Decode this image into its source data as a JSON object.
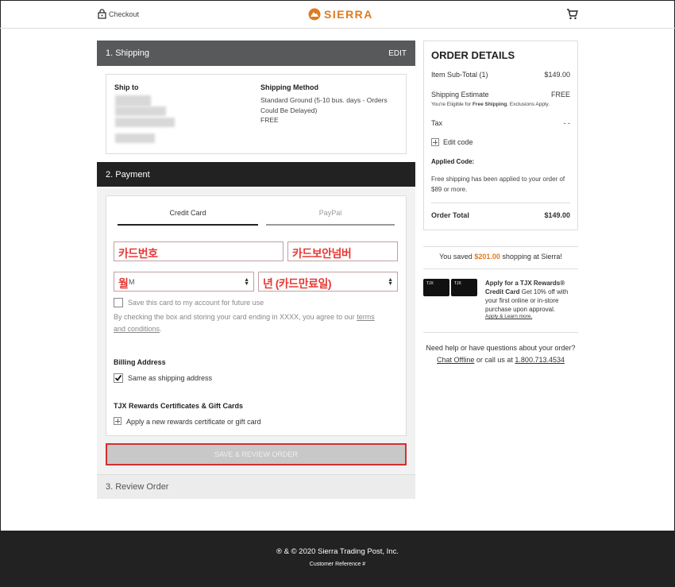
{
  "header": {
    "checkout_label": "Checkout",
    "brand": "SIERRA",
    "icons": [
      "lock-icon",
      "sierra-logo-icon",
      "cart-icon"
    ]
  },
  "shipping": {
    "step_title": "1. Shipping",
    "edit_label": "EDIT",
    "ship_to_label": "Ship to",
    "method_label": "Shipping Method",
    "method_text": "Standard Ground (5-10 bus. days - Orders Could Be Delayed)",
    "method_cost": "FREE"
  },
  "payment": {
    "step_title": "2. Payment",
    "tab_credit": "Credit Card",
    "tab_paypal": "PayPal",
    "card_number_annotation": "카드번호",
    "security_code_annotation": "카드보안넘버",
    "month_annotation": "월",
    "month_value": "M",
    "year_annotation": "년 (카드만료일)",
    "save_card_label": "Save this card to my account for future use",
    "consent_text": "By checking the box and storing your card ending in XXXX, you agree to our ",
    "terms_link": "terms and conditions",
    "consent_end": ".",
    "billing_title": "Billing Address",
    "same_address_label": "Same as shipping address",
    "same_address_checked": true,
    "tjx_title": "TJX Rewards Certificates & Gift Cards",
    "tjx_apply_label": "Apply a new rewards certificate or gift card",
    "save_review_button": "SAVE & REVIEW ORDER"
  },
  "review": {
    "step_title": "3. Review Order"
  },
  "order_details": {
    "title": "ORDER DETAILS",
    "subtotal_label": "Item Sub-Total (1)",
    "subtotal_value": "$149.00",
    "shipping_label": "Shipping Estimate",
    "shipping_value": "FREE",
    "shipping_note_pre": "You're Eligible for ",
    "shipping_note_bold": "Free Shipping",
    "shipping_note_post": ". Exclusions Apply.",
    "tax_label": "Tax",
    "tax_value": "- -",
    "edit_code_label": "Edit code",
    "applied_code_label": "Applied Code:",
    "applied_code_text": "Free shipping has been applied to your order of $89 or more.",
    "total_label": "Order Total",
    "total_value": "$149.00"
  },
  "savings": {
    "pre": "You saved ",
    "amount": "$201.00",
    "post": " shopping at Sierra!",
    "amount_color": "#e07a1e"
  },
  "promo": {
    "title": "Apply for a TJX Rewards® Credit Card",
    "text": " Get 10% off with your first online or in-store purchase upon approval.",
    "link": "Apply & Learn more.",
    "card_labels": [
      "TJX",
      "TJX"
    ]
  },
  "help": {
    "question": "Need help or have questions about your order?",
    "chat_link": "Chat Offline",
    "mid": " or call us at ",
    "phone": "1.800.713.4534"
  },
  "footer": {
    "copyright": "® & © 2020 Sierra Trading Post, Inc.",
    "reference": "Customer Reference #"
  },
  "colors": {
    "accent": "#e07a1e",
    "step_bar": "#58595b",
    "highlight": "#d32f2f"
  }
}
